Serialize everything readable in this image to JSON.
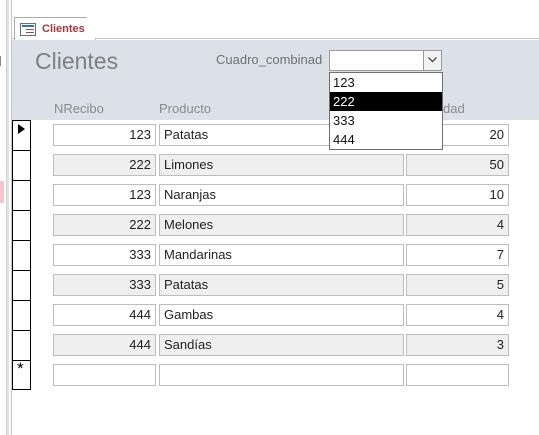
{
  "tab": {
    "label": "Clientes"
  },
  "form": {
    "title": "Clientes",
    "combo_label": "Cuadro_combinad",
    "combo_value": ""
  },
  "columns": {
    "nrecibo": "NRecibo",
    "producto": "Producto",
    "cantidad": "dad"
  },
  "dropdown": {
    "options": [
      "123",
      "222",
      "333",
      "444"
    ],
    "selected_index": 1
  },
  "rows": [
    {
      "nrecibo": "123",
      "producto": "Patatas",
      "cantidad": "20"
    },
    {
      "nrecibo": "222",
      "producto": "Limones",
      "cantidad": "50"
    },
    {
      "nrecibo": "123",
      "producto": "Naranjas",
      "cantidad": "10"
    },
    {
      "nrecibo": "222",
      "producto": "Melones",
      "cantidad": "4"
    },
    {
      "nrecibo": "333",
      "producto": "Mandarinas",
      "cantidad": "7"
    },
    {
      "nrecibo": "333",
      "producto": "Patatas",
      "cantidad": "5"
    },
    {
      "nrecibo": "444",
      "producto": "Gambas",
      "cantidad": "4"
    },
    {
      "nrecibo": "444",
      "producto": "Sandías",
      "cantidad": "3"
    }
  ],
  "new_row_marker": "*"
}
